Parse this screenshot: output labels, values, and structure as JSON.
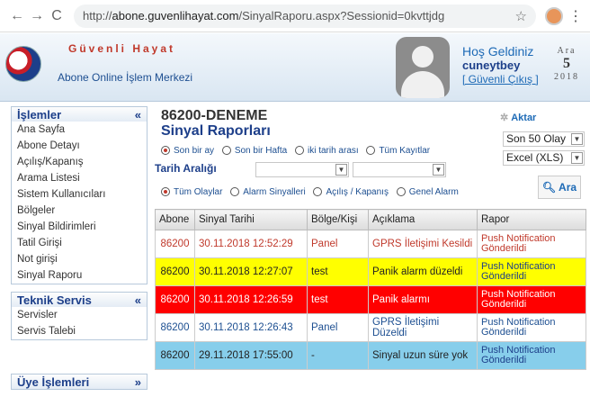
{
  "browser": {
    "url_prefix": "http://",
    "url_host": "abone.guvenlihayat.com",
    "url_path": "/SinyalRaporu.aspx?Sessionid=0kvttjdg"
  },
  "header": {
    "brand": "Güvenli Hayat",
    "subtitle": "Abone Online İşlem Merkezi",
    "welcome": "Hoş Geldiniz",
    "username": "cuneytbey",
    "logout": "[ Güvenli Çıkış ]",
    "date_month": "Ara",
    "date_day": "5",
    "date_year": "2018"
  },
  "sidebar": {
    "islemler_title": "İşlemler",
    "islemler_items": [
      "Ana Sayfa",
      "Abone Detayı",
      "Açılış/Kapanış",
      "Arama Listesi",
      "Sistem Kullanıcıları",
      "Bölgeler",
      "Sinyal Bildirimleri",
      "Tatil Girişi",
      "Not girişi",
      "Sinyal Raporu"
    ],
    "teknik_title": "Teknik Servis",
    "teknik_items": [
      "Servisler",
      "Servis Talebi"
    ],
    "uye_title": "Üye İşlemleri"
  },
  "main": {
    "code": "86200-DENEME",
    "title": "Sinyal Raporları",
    "aktar": "Aktar",
    "period_options": [
      "Son bir ay",
      "Son bir Hafta",
      "iki tarih arası",
      "Tüm Kayıtlar"
    ],
    "tarih_label": "Tarih Aralığı",
    "type_options": [
      "Tüm Olaylar",
      "Alarm Sinyalleri",
      "Açılış / Kapanış",
      "Genel Alarm"
    ],
    "count_select": "Son 50 Olay",
    "format_select": "Excel (XLS)",
    "ara_button": "Ara"
  },
  "table": {
    "headers": [
      "Abone",
      "Sinyal Tarihi",
      "Bölge/Kişi",
      "Açıklama",
      "Rapor"
    ],
    "rows": [
      {
        "abone": "86200",
        "tarih": "30.11.2018 12:52:29",
        "bolge": "Panel",
        "aciklama": "GPRS İletişimi Kesildi",
        "rapor": "Push Notification Gönderildi"
      },
      {
        "abone": "86200",
        "tarih": "30.11.2018 12:27:07",
        "bolge": "test",
        "aciklama": "Panik alarm düzeldi",
        "rapor": "Push Notification Gönderildi"
      },
      {
        "abone": "86200",
        "tarih": "30.11.2018 12:26:59",
        "bolge": "test",
        "aciklama": "Panik alarmı",
        "rapor": "Push Notification Gönderildi"
      },
      {
        "abone": "86200",
        "tarih": "30.11.2018 12:26:43",
        "bolge": "Panel",
        "aciklama": "GPRS İletişimi Düzeldi",
        "rapor": "Push Notification Gönderildi"
      },
      {
        "abone": "86200",
        "tarih": "29.11.2018 17:55:00",
        "bolge": "-",
        "aciklama": "Sinyal uzun süre yok",
        "rapor": "Push Notification Gönderildi"
      }
    ]
  },
  "colors": {
    "brand_red": "#c0392b",
    "brand_blue": "#1d3f8a",
    "row_yellow": "#ffff00",
    "row_red": "#ff0000",
    "row_sky": "#87ceeb"
  }
}
